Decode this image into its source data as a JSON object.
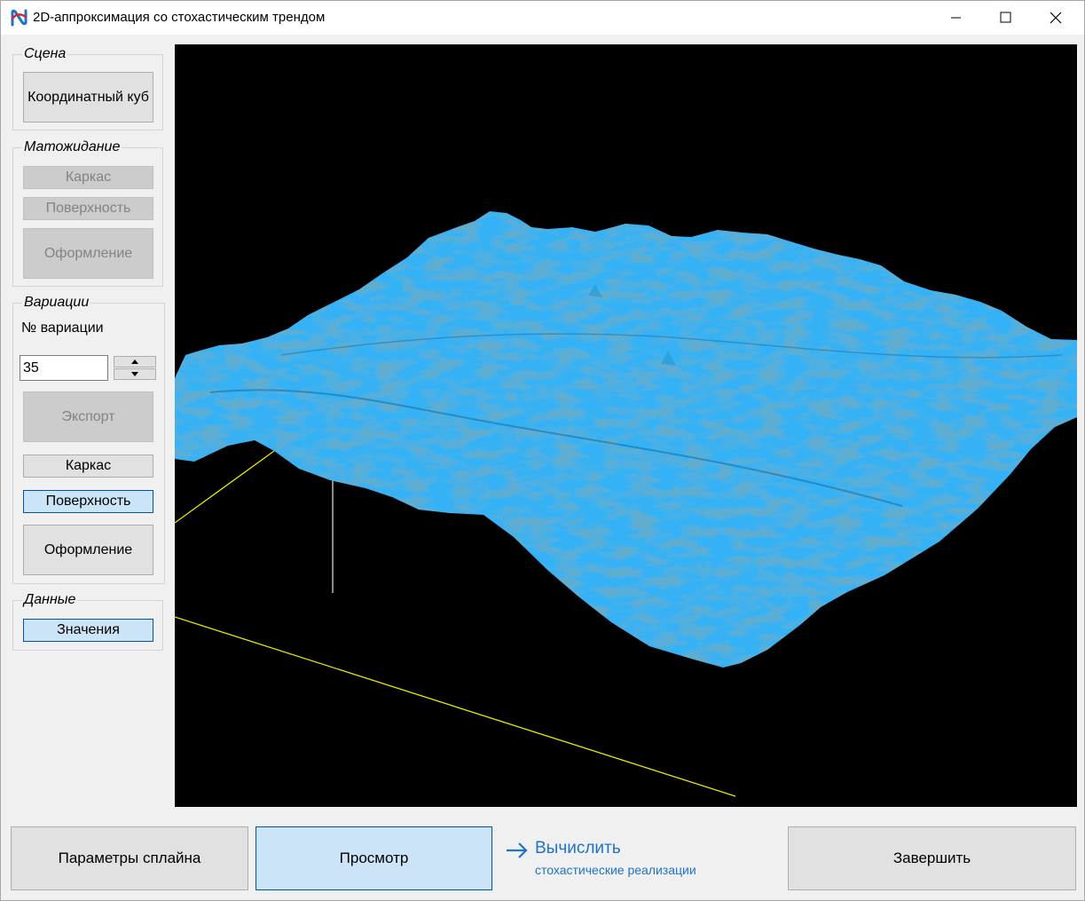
{
  "window": {
    "title": "2D-аппроксимация со стохастическим трендом",
    "controls": [
      "minimize-icon",
      "maximize-icon",
      "close-icon"
    ]
  },
  "scene": {
    "group_title": "Сцена",
    "coord_cube_label": "Координатный куб"
  },
  "expectation": {
    "group_title": "Матожидание",
    "wireframe_label": "Каркас",
    "surface_label": "Поверхность",
    "styling_label": "Оформление"
  },
  "variations": {
    "group_title": "Вариации",
    "number_label": "№ вариации",
    "number_value": "35",
    "export_label": "Экспорт",
    "wireframe_label": "Каркас",
    "surface_label": "Поверхность",
    "styling_label": "Оформление"
  },
  "data": {
    "group_title": "Данные",
    "values_label": "Значения"
  },
  "bottom": {
    "spline_params_label": "Параметры сплайна",
    "view_label": "Просмотр",
    "compute_label": "Вычислить",
    "compute_sub_label": "стохастические реализации",
    "finish_label": "Завершить"
  },
  "colors": {
    "surface": "#35b2f5",
    "surface_shade": "#1f6f9a",
    "viewport_bg": "#000000",
    "axis_line": "#e8e800",
    "accent": "#1e73c6",
    "active_button": "#cce4f7"
  }
}
